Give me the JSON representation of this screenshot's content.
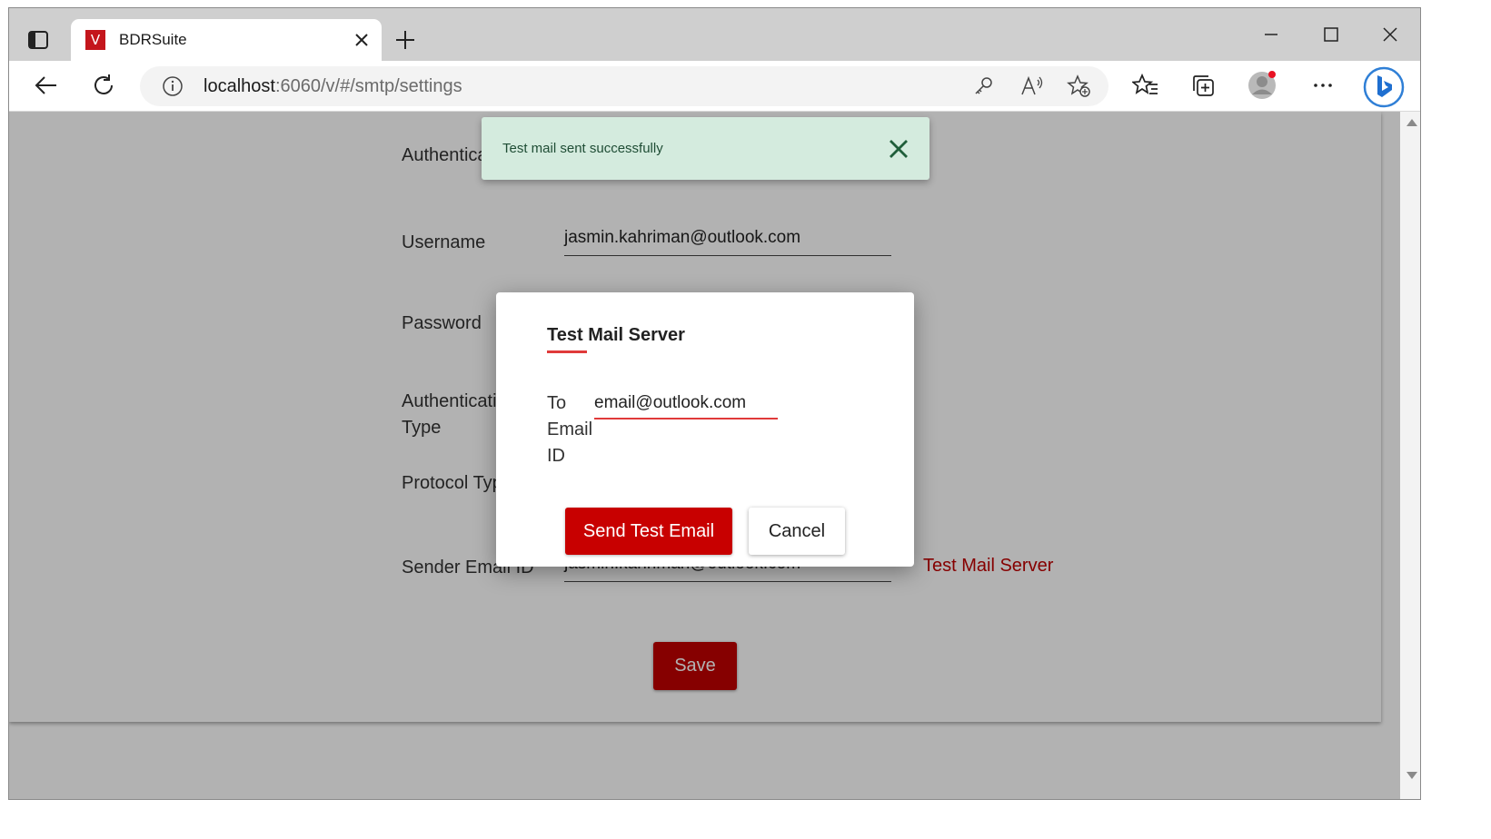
{
  "browser": {
    "tab": {
      "title": "BDRSuite",
      "favicon_letter": "V"
    },
    "address": {
      "host": "localhost",
      "path": ":6060/v/#/smtp/settings"
    },
    "icons": [
      "tab-actions-icon",
      "close-icon",
      "plus-icon",
      "minimize-icon",
      "maximize-icon",
      "close-window-icon",
      "back-icon",
      "refresh-icon",
      "info-icon",
      "key-icon",
      "read-aloud-icon",
      "add-favorite-icon",
      "favorites-icon",
      "collections-icon",
      "profile-icon",
      "more-icon",
      "bing-icon"
    ]
  },
  "form": {
    "authentication_label": "Authentication",
    "username_label": "Username",
    "username_value": "jasmin.kahriman@outlook.com",
    "password_label": "Password",
    "auth_type_label": "Authentication Type",
    "protocol_type_label": "Protocol Type",
    "sender_email_label": "Sender Email ID",
    "sender_email_value": "jasmin.kahriman@outlook.com",
    "test_mail_link": "Test Mail Server",
    "save_label": "Save"
  },
  "toast": {
    "message": "Test mail sent successfully",
    "color": "#d4ebde"
  },
  "modal": {
    "title": "Test Mail Server",
    "to_label": "To Email ID",
    "to_value": "email@outlook.com",
    "send_label": "Send Test Email",
    "cancel_label": "Cancel"
  },
  "colors": {
    "accent": "#c80000",
    "link": "#c00000",
    "underline_accent": "#e03a3a"
  }
}
